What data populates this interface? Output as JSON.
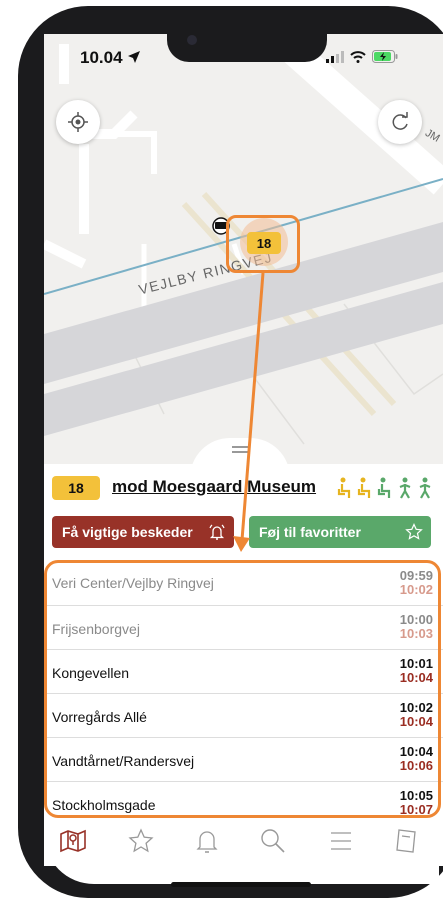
{
  "status_bar": {
    "time": "10.04"
  },
  "map": {
    "street_label": "VEJLBY RINGVEJ",
    "edge_label": "JM",
    "bus_badge": "18"
  },
  "route": {
    "number": "18",
    "destination": "mod Moesgaard Museum",
    "alerts_button": "Få vigtige beskeder",
    "favorites_button": "Føj til favoritter"
  },
  "stops": [
    {
      "name": "Veri Center/Vejlby Ringvej",
      "scheduled": "09:59",
      "expected": "10:02",
      "state": "past"
    },
    {
      "name": "Frijsenborgvej",
      "scheduled": "10:00",
      "expected": "10:03",
      "state": "past"
    },
    {
      "name": "Kongevellen",
      "scheduled": "10:01",
      "expected": "10:04",
      "state": "live"
    },
    {
      "name": "Vorregårds Allé",
      "scheduled": "10:02",
      "expected": "10:04",
      "state": "live"
    },
    {
      "name": "Vandtårnet/Randersvej",
      "scheduled": "10:04",
      "expected": "10:06",
      "state": "live"
    },
    {
      "name": "Stockholmsgade",
      "scheduled": "10:05",
      "expected": "10:07",
      "state": "live"
    }
  ],
  "tabbar": [
    "map-icon",
    "star-icon",
    "bell-icon",
    "search-icon",
    "menu-icon",
    "ticket-icon"
  ],
  "colors": {
    "route_yellow": "#f3c13a",
    "alerts_red": "#983228",
    "favorites_green": "#5aa86a",
    "annotation_orange": "#ee8734",
    "late_time": "#9a2d22"
  }
}
